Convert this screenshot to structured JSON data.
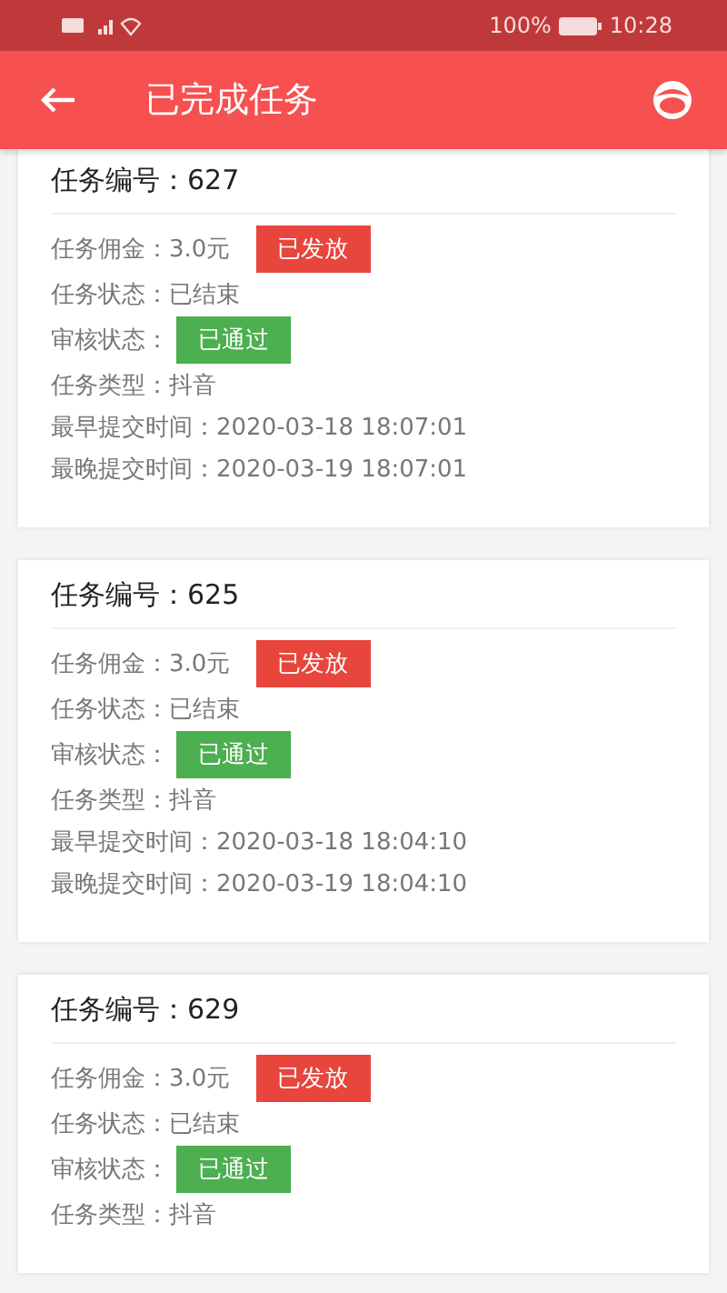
{
  "status_bar": {
    "battery": "100%",
    "time": "10:28"
  },
  "header": {
    "title": "已完成任务"
  },
  "tasks": [
    {
      "title": "任务编号：627",
      "rows": [
        {
          "label": "任务佣金：",
          "value": "3.0元",
          "badge": {
            "text": "已发放",
            "color": "#e8453c"
          }
        },
        {
          "label": "任务状态：",
          "value": "已结束"
        },
        {
          "label": "审核状态：",
          "badge": {
            "text": "已通过",
            "color": "#4caf50"
          }
        },
        {
          "label": "任务类型：",
          "value": "抖音"
        },
        {
          "label": "最早提交时间：",
          "value": "2020-03-18 18:07:01"
        },
        {
          "label": "最晚提交时间：",
          "value": "2020-03-19 18:07:01"
        }
      ]
    },
    {
      "title": "任务编号：625",
      "rows": [
        {
          "label": "任务佣金：",
          "value": "3.0元",
          "badge": {
            "text": "已发放",
            "color": "#e8453c"
          }
        },
        {
          "label": "任务状态：",
          "value": "已结束"
        },
        {
          "label": "审核状态：",
          "badge": {
            "text": "已通过",
            "color": "#4caf50"
          }
        },
        {
          "label": "任务类型：",
          "value": "抖音"
        },
        {
          "label": "最早提交时间：",
          "value": "2020-03-18 18:04:10"
        },
        {
          "label": "最晚提交时间：",
          "value": "2020-03-19 18:04:10"
        }
      ]
    },
    {
      "title": "任务编号：629",
      "rows": [
        {
          "label": "任务佣金：",
          "value": "3.0元",
          "badge": {
            "text": "已发放",
            "color": "#e8453c"
          }
        },
        {
          "label": "任务状态：",
          "value": "已结束"
        },
        {
          "label": "审核状态：",
          "badge": {
            "text": "已通过",
            "color": "#4caf50"
          }
        },
        {
          "label": "任务类型：",
          "value": "抖音"
        }
      ]
    }
  ]
}
